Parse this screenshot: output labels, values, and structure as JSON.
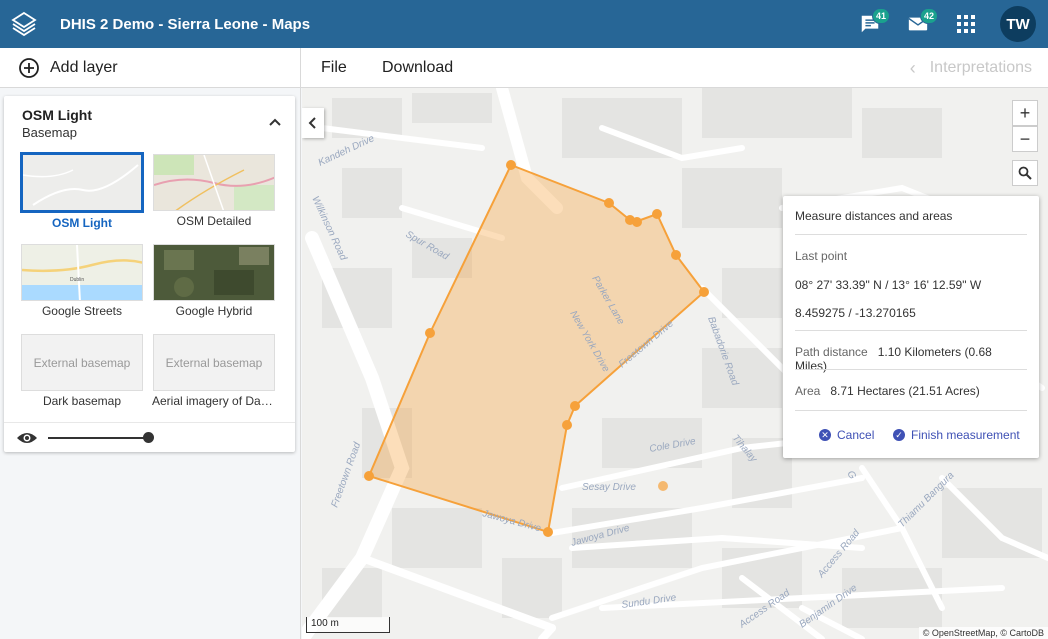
{
  "header": {
    "app_title": "DHIS 2 Demo - Sierra Leone - Maps",
    "messages_count": "41",
    "mail_count": "42",
    "user_initials": "TW"
  },
  "toolbar": {
    "add_layer": "Add layer",
    "file": "File",
    "download": "Download",
    "interpretations": "Interpretations"
  },
  "layer_card": {
    "title": "OSM Light",
    "subtitle": "Basemap",
    "basemaps": [
      {
        "label": "OSM Light",
        "selected": true
      },
      {
        "label": "OSM Detailed",
        "selected": false
      },
      {
        "label": "Google Streets",
        "selected": false
      },
      {
        "label": "Google Hybrid",
        "selected": false
      },
      {
        "label": "Dark basemap",
        "selected": false,
        "placeholder": "External basemap"
      },
      {
        "label": "Aerial imagery of Dar…",
        "selected": false,
        "placeholder": "External basemap"
      }
    ],
    "opacity": 1.0
  },
  "map": {
    "streets": [
      "Kandeh Drive",
      "Spur Road",
      "Wilkinson Road",
      "Parker Lane",
      "New York Drive",
      "Freetown Drive",
      "Babadorie Road",
      "Cole Drive",
      "Sesay Drive",
      "Jawoya Drive",
      "Freetown Road",
      "Tihalay",
      "Thiamu Bangura",
      "Access Road",
      "Benjamin Drive",
      "Access Road",
      "Sundu Drive",
      "Jawoya Drive"
    ],
    "street_label_g": "G",
    "thumb_town": "Dublin",
    "scale_label": "100 m",
    "attribution": "© OpenStreetMap, © CartoDB"
  },
  "measure": {
    "title": "Measure distances and areas",
    "last_point_label": "Last point",
    "dms": "08° 27' 33.39\" N / 13° 16' 12.59\" W",
    "decimal": "8.459275 / -13.270165",
    "path_label": "Path distance",
    "path_value": "1.10 Kilometers (0.68 Miles)",
    "area_label": "Area",
    "area_value": "8.71 Hectares (21.51 Acres)",
    "cancel": "Cancel",
    "finish": "Finish measurement"
  },
  "colors": {
    "header": "#276696",
    "measure_orange": "#f6a13a",
    "accent": "#1565c0",
    "button": "#3f51b5"
  }
}
